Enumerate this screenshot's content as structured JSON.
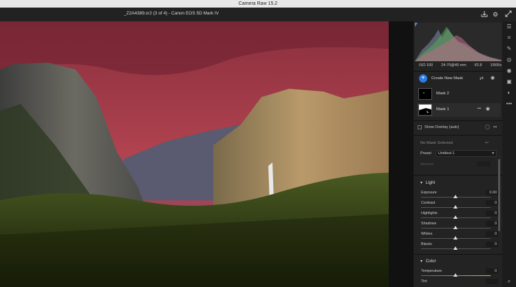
{
  "app": {
    "title": "Camera Raw 15.2"
  },
  "file": {
    "title": "_Z2A4389.cr2 (3 of 4)  -  Canon EOS 5D Mark IV"
  },
  "exif": {
    "iso": "ISO 100",
    "lens": "24-70@40 mm",
    "aperture": "f/2.8",
    "shutter": "1/500s"
  },
  "masks": {
    "create_label": "Create New Mask",
    "items": [
      {
        "label": "Mask 2"
      },
      {
        "label": "Mask 1"
      }
    ],
    "overlay_label": "Show Overlay (auto)",
    "no_mask_label": "No Mask Selected",
    "preset_label": "Preset",
    "preset_value": "Untitled-1",
    "amount_label": "Amount"
  },
  "light": {
    "title": "Light",
    "sliders": [
      {
        "label": "Exposure",
        "value": "0.00"
      },
      {
        "label": "Contrast",
        "value": "0"
      },
      {
        "label": "Highlights",
        "value": "0"
      },
      {
        "label": "Shadows",
        "value": "0"
      },
      {
        "label": "Whites",
        "value": "0"
      },
      {
        "label": "Blacks",
        "value": "0"
      }
    ]
  },
  "color": {
    "title": "Color",
    "sliders": [
      {
        "label": "Temperature",
        "value": "0"
      },
      {
        "label": "Tint",
        "value": ""
      }
    ]
  },
  "icons": {
    "collapse": "▾",
    "more": "•••",
    "eye": "◉"
  }
}
